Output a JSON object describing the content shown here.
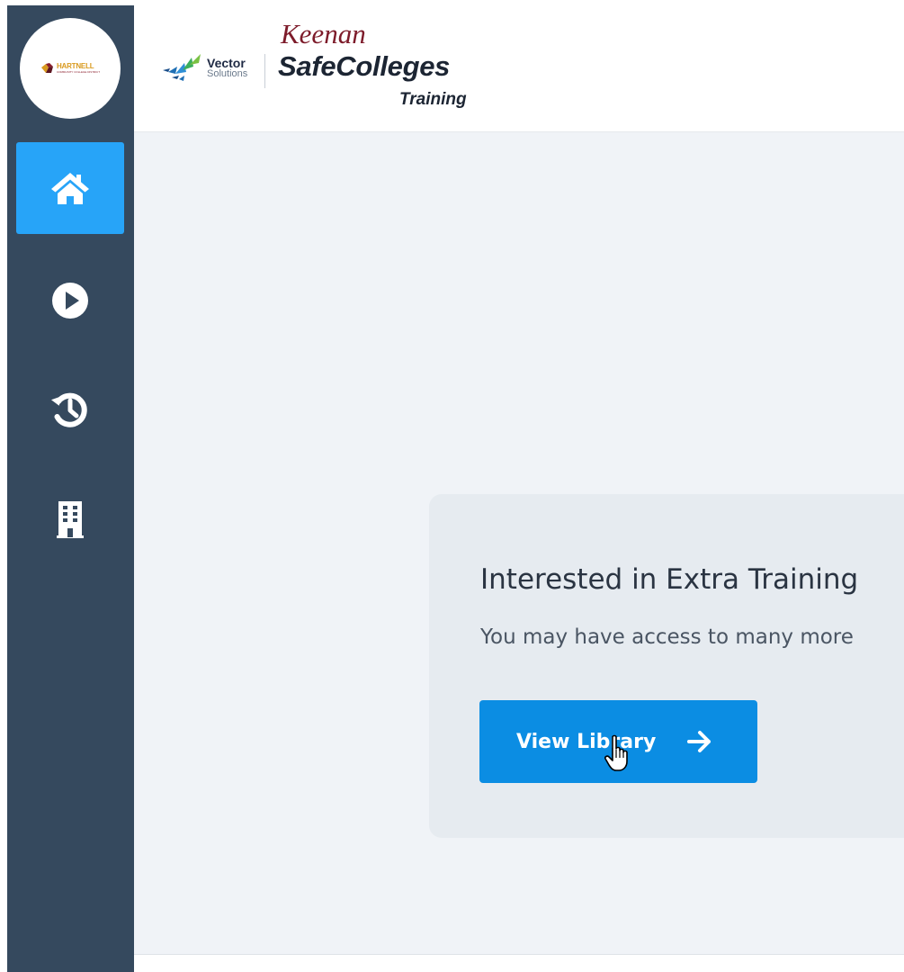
{
  "org_logo": {
    "name": "HARTNELL",
    "subtitle": "COMMUNITY COLLEGE DISTRICT"
  },
  "sidebar": {
    "items": [
      {
        "icon": "home-icon",
        "active": true
      },
      {
        "icon": "play-circle-icon",
        "active": false
      },
      {
        "icon": "history-icon",
        "active": false
      },
      {
        "icon": "building-icon",
        "active": false
      }
    ],
    "colors": {
      "background": "#35495e",
      "active": "#27a4f8"
    }
  },
  "header": {
    "vector_word": "Vector",
    "solutions_word": "Solutions",
    "keenan": "Keenan",
    "brand": "SafeColleges",
    "brand_sub": "Training"
  },
  "card": {
    "title": "Interested in Extra Training",
    "text": "You may have access to many more",
    "button_label": "View Library",
    "button_color": "#0b8de3"
  }
}
